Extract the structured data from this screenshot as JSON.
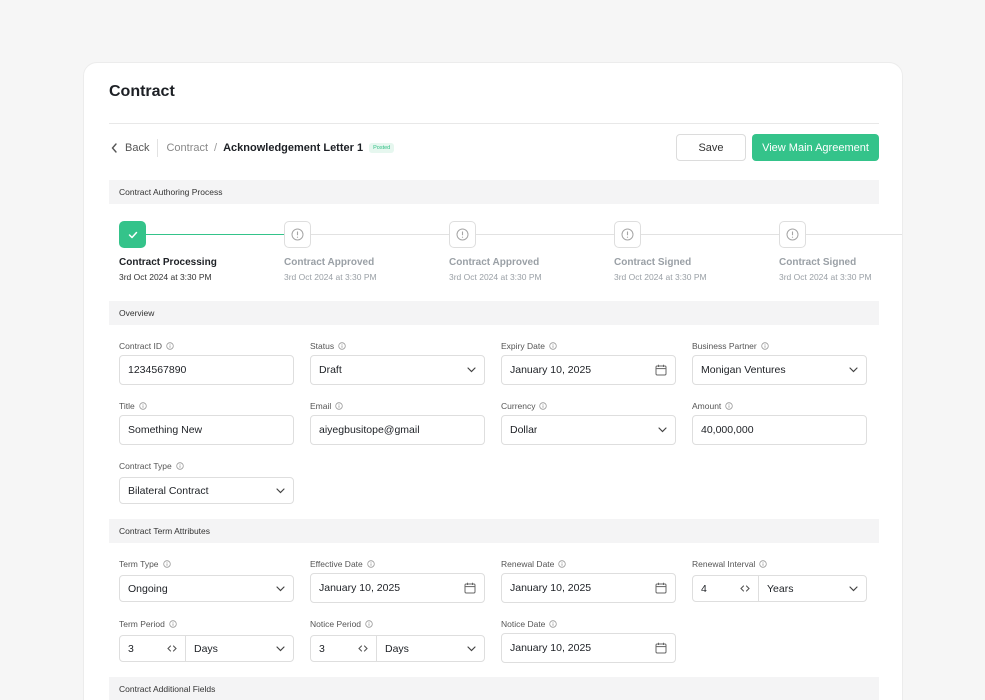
{
  "page": {
    "title": "Contract"
  },
  "breadcrumb": {
    "back_label": "Back",
    "parent": "Contract",
    "separator": "/",
    "current": "Acknowledgement Letter 1",
    "status_badge": "Posted"
  },
  "actions": {
    "save_label": "Save",
    "view_main_label": "View Main Agreement"
  },
  "colors": {
    "accent": "#34c38a",
    "section_bg": "#f4f4f5",
    "border": "#dedede"
  },
  "sections": {
    "authoring": "Contract Authoring Process",
    "overview": "Overview",
    "term": "Contract Term Attributes",
    "additional": "Contract Additional Fields"
  },
  "steps": [
    {
      "label": "Contract Processing",
      "date": "3rd Oct 2024 at 3:30 PM",
      "state": "completed",
      "icon": "check-icon"
    },
    {
      "label": "Contract Approved",
      "date": "3rd Oct 2024 at 3:30 PM",
      "state": "pending",
      "icon": "info-icon"
    },
    {
      "label": "Contract Approved",
      "date": "3rd Oct 2024 at 3:30 PM",
      "state": "pending",
      "icon": "info-icon"
    },
    {
      "label": "Contract Signed",
      "date": "3rd Oct 2024 at 3:30 PM",
      "state": "pending",
      "icon": "info-icon"
    },
    {
      "label": "Contract Signed",
      "date": "3rd Oct 2024 at 3:30 PM",
      "state": "pending",
      "icon": "info-icon"
    }
  ],
  "overview": {
    "contract_id": {
      "label": "Contract ID",
      "value": "1234567890"
    },
    "status": {
      "label": "Status",
      "value": "Draft"
    },
    "expiry_date": {
      "label": "Expiry Date",
      "value": "January 10, 2025"
    },
    "business_partner": {
      "label": "Business Partner",
      "value": "Monigan Ventures"
    },
    "title": {
      "label": "Title",
      "value": "Something New"
    },
    "email": {
      "label": "Email",
      "value": "aiyegbusitope@gmail"
    },
    "currency": {
      "label": "Currency",
      "value": "Dollar"
    },
    "amount": {
      "label": "Amount",
      "value": "40,000,000"
    },
    "contract_type": {
      "label": "Contract Type",
      "value": "Bilateral Contract"
    }
  },
  "term": {
    "term_type": {
      "label": "Term Type",
      "value": "Ongoing"
    },
    "effective_date": {
      "label": "Effective Date",
      "value": "January 10, 2025"
    },
    "renewal_date": {
      "label": "Renewal Date",
      "value": "January 10, 2025"
    },
    "renewal_interval": {
      "label": "Renewal Interval",
      "number": "4",
      "unit": "Years"
    },
    "term_period": {
      "label": "Term Period",
      "number": "3",
      "unit": "Days"
    },
    "notice_period": {
      "label": "Notice Period",
      "number": "3",
      "unit": "Days"
    },
    "notice_date": {
      "label": "Notice Date",
      "value": "January 10, 2025"
    }
  }
}
